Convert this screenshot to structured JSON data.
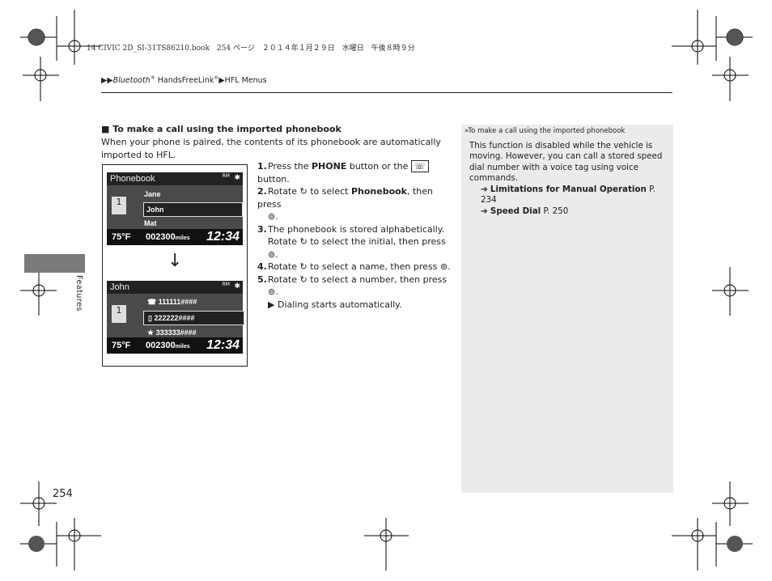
{
  "header_line": "14 CIVIC 2D_SI-31TS86210.book　254 ページ　２０１４年１月２９日　水曜日　午後８時９分",
  "breadcrumb": {
    "part1": "Bluetooth",
    "reg1": "®",
    "part2": " HandsFreeLink",
    "reg2": "®",
    "part3": "HFL Menus"
  },
  "side_tab": "Features",
  "heading": "To make a call using the imported phonebook",
  "intro": "When your phone is paired, the contents of its phonebook are automatically imported to HFL.",
  "steps": [
    {
      "n": "1.",
      "a": "Press the ",
      "b": "PHONE",
      "c": " button or the ",
      "d": " button."
    },
    {
      "n": "2.",
      "a": "Rotate ",
      "b": " to select ",
      "c": "Phonebook",
      "d": ", then press"
    },
    {
      "n": "3.",
      "a": "The phonebook is stored alphabetically.",
      "b": "Rotate ",
      "c": " to select the initial, then press"
    },
    {
      "n": "4.",
      "a": "Rotate ",
      "b": " to select a name, then press "
    },
    {
      "n": "5.",
      "a": "Rotate ",
      "b": " to select a number, then press"
    }
  ],
  "result": "Dialing starts automatically.",
  "sidebar": {
    "title": "To make a call using the imported phonebook",
    "body": "This function is disabled while the vehicle is moving. However, you can call a stored speed dial number with a voice tag using voice commands.",
    "links": [
      {
        "label": "Limitations for Manual Operation",
        "page": "P. 234"
      },
      {
        "label": "Speed Dial",
        "page": "P. 250"
      }
    ]
  },
  "screen1": {
    "title": "Phonebook",
    "items": [
      "Jane",
      "John",
      "Mat"
    ],
    "selected": "John",
    "temp": "75°F",
    "odo": "002300",
    "unit": "miles",
    "time": "12:34"
  },
  "screen2": {
    "title": "John",
    "items": [
      "111111####",
      "222222####",
      "333333####"
    ],
    "selected": "222222####",
    "temp": "75°F",
    "odo": "002300",
    "unit": "miles",
    "time": "12:34"
  },
  "status_rm": "RM",
  "page_number": "254"
}
